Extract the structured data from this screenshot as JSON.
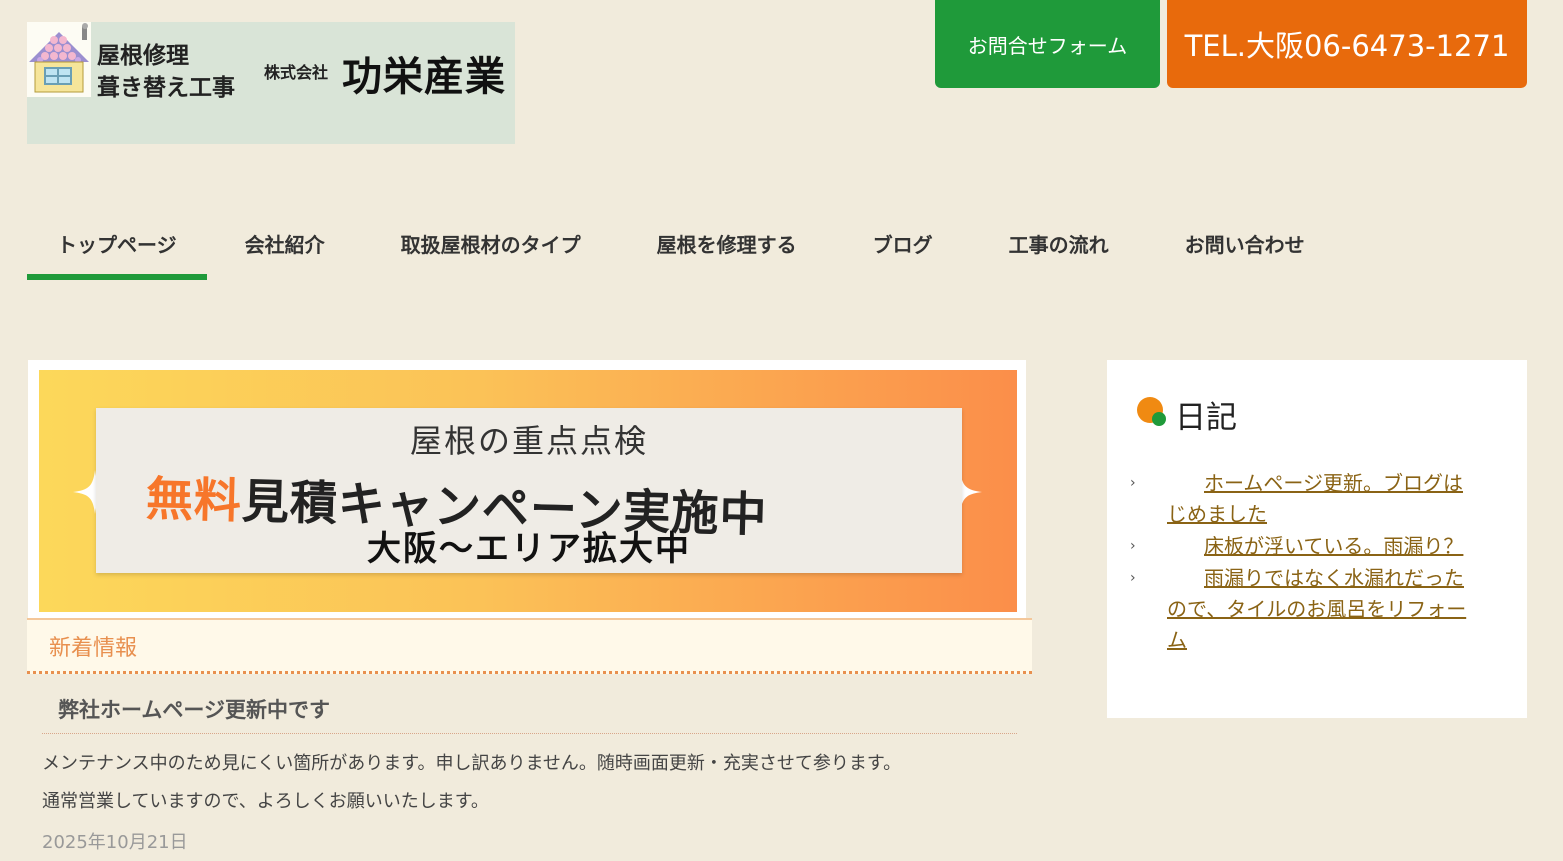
{
  "header": {
    "logo": {
      "tagline1": "屋根修理",
      "tagline2": "葺き替え工事",
      "company_prefix": "株式会社",
      "company_name": "功栄産業"
    },
    "contact_button": "お問合せフォーム",
    "tel_button": "TEL.大阪06-6473-1271"
  },
  "nav": {
    "items": [
      {
        "label": "トップページ",
        "active": true
      },
      {
        "label": "会社紹介"
      },
      {
        "label": "取扱屋根材のタイプ"
      },
      {
        "label": "屋根を修理する"
      },
      {
        "label": "ブログ"
      },
      {
        "label": "工事の流れ"
      },
      {
        "label": "お問い合わせ"
      }
    ]
  },
  "banner": {
    "subtitle": "屋根の重点点検",
    "free_word": "無料",
    "main_text": "見積キャンペーン実施中",
    "area_text": "大阪〜エリア拡大中"
  },
  "news": {
    "header": "新着情報",
    "post_title": "弊社ホームページ更新中です",
    "body_line1": "メンテナンス中のため見にくい箇所があります。申し訳ありません。随時画面更新・充実させて参ります。",
    "body_line2": "通常営業していますので、よろしくお願いいたします。",
    "date": "2025年10月21日"
  },
  "sidebar": {
    "title": "日記",
    "items": [
      {
        "label": "ホームページ更新。ブログはじめました"
      },
      {
        "label": "床板が浮いている。雨漏り？"
      },
      {
        "label": "雨漏りではなく水漏れだったので、タイルのお風呂をリフォーム"
      }
    ]
  },
  "colors": {
    "page_bg": "#f1ebdc",
    "green": "#1f9a3a",
    "orange": "#e86a0c",
    "link": "#8a6315",
    "news_accent": "#e8904f"
  }
}
